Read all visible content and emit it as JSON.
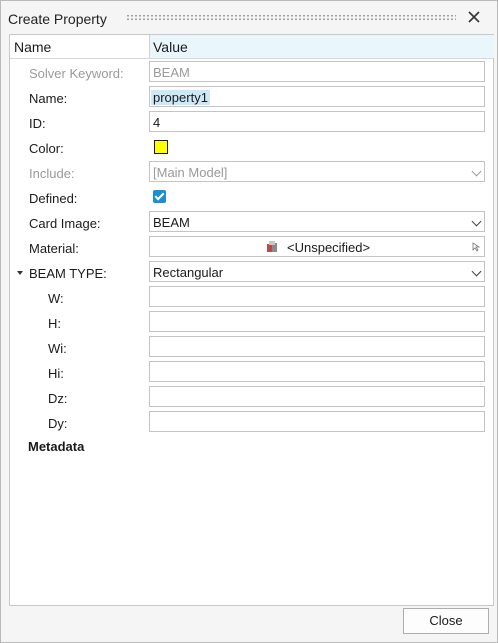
{
  "window": {
    "title": "Create Property"
  },
  "table": {
    "header": {
      "name": "Name",
      "value": "Value"
    },
    "rows": {
      "solver_keyword": {
        "label": "Solver Keyword:",
        "value": "BEAM"
      },
      "name": {
        "label": "Name:",
        "value": "property1"
      },
      "id": {
        "label": "ID:",
        "value": "4"
      },
      "color": {
        "label": "Color:",
        "value": "#ffff00"
      },
      "include": {
        "label": "Include:",
        "value": "[Main Model]"
      },
      "defined": {
        "label": "Defined:",
        "checked": true
      },
      "card_image": {
        "label": "Card Image:",
        "value": "BEAM"
      },
      "material": {
        "label": "Material:",
        "value": "<Unspecified>"
      },
      "beam_type": {
        "label": "BEAM TYPE:",
        "value": "Rectangular"
      },
      "w": {
        "label": "W:",
        "value": ""
      },
      "h": {
        "label": "H:",
        "value": ""
      },
      "wi": {
        "label": "Wi:",
        "value": ""
      },
      "hi": {
        "label": "Hi:",
        "value": ""
      },
      "dz": {
        "label": "Dz:",
        "value": ""
      },
      "dy": {
        "label": "Dy:",
        "value": ""
      }
    },
    "metadata_label": "Metadata"
  },
  "footer": {
    "close_label": "Close"
  },
  "icons": {
    "close": "close-icon",
    "material": "material-icon",
    "dropdown": "chevron-down-icon",
    "expand": "caret-down-icon",
    "checkbox": "checkmark-icon"
  }
}
